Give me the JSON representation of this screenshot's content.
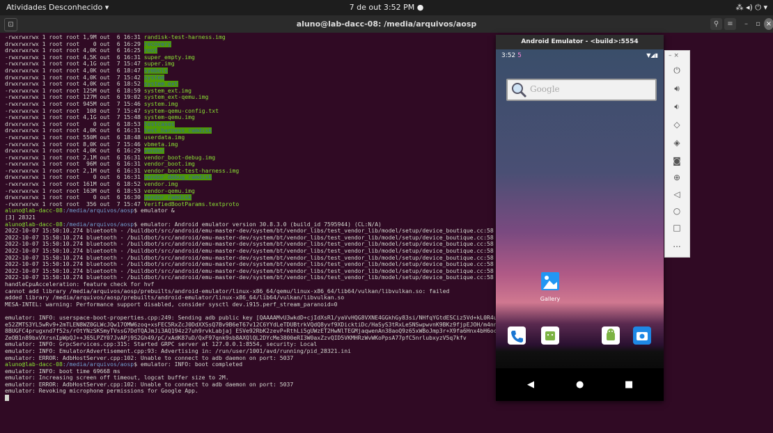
{
  "topbar": {
    "activities": "Atividades",
    "app_menu": "Desconhecido ▾",
    "clock": "7 de out  3:52 PM ●",
    "tray": "⁂ ◂) ⏻ ▾"
  },
  "window": {
    "title": "aluno@lab-dacc-08: /media/arquivos/aosp"
  },
  "terminal": {
    "lines": [
      {
        "pre": "-rwxrwxrwx 1 root root 1,9M out  6 16:31 ",
        "name": "randisk-test-harness.img",
        "style": "green"
      },
      {
        "pre": "drwxrwxrwx 1 root root    0 out  6 16:29 ",
        "name": "recovery",
        "style": "hl"
      },
      {
        "pre": "drwxrwxrwx 1 root root 4,0K out  6 16:25 ",
        "name": "root",
        "style": "hl"
      },
      {
        "pre": "-rwxrwxrwx 1 root root 4,5K out  6 16:31 ",
        "name": "super_empty.img",
        "style": "green"
      },
      {
        "pre": "-rwxrwxrwx 1 root root 4,1G out  7 15:47 ",
        "name": "super.img",
        "style": "green"
      },
      {
        "pre": "drwxrwxrwx 1 root root 4,0K out  6 18:47 ",
        "name": "symbols",
        "style": "hl"
      },
      {
        "pre": "drwxrwxrwx 1 root root 4,0K out  7 15:42 ",
        "name": "system",
        "style": "hl"
      },
      {
        "pre": "drwxrwxrwx 1 root root 4,0K out  6 18:52 ",
        "name": "system_ext",
        "style": "hl"
      },
      {
        "pre": "-rwxrwxrwx 1 root root 125M out  6 18:59 ",
        "name": "system_ext.img",
        "style": "green"
      },
      {
        "pre": "-rwxrwxrwx 1 root root 127M out  6 19:02 ",
        "name": "system_ext-qemu.img",
        "style": "green"
      },
      {
        "pre": "-rwxrwxrwx 1 root root 945M out  7 15:46 ",
        "name": "system.img",
        "style": "green"
      },
      {
        "pre": "-rwxrwxrwx 1 root root  108 out  7 15:47 ",
        "name": "system-qemu-config.txt",
        "style": "green"
      },
      {
        "pre": "-rwxrwxrwx 1 root root 4,1G out  7 15:48 ",
        "name": "system-qemu.img",
        "style": "green"
      },
      {
        "pre": "drwxrwxrwx 1 root root    0 out  6 18:53 ",
        "name": "testcases",
        "style": "hl"
      },
      {
        "pre": "drwxrwxrwx 1 root root 4,0K out  6 16:31 ",
        "name": "test_harness_ramdisk",
        "style": "hl"
      },
      {
        "pre": "-rwxrwxrwx 1 root root 550M out  6 18:48 ",
        "name": "userdata.img",
        "style": "green"
      },
      {
        "pre": "-rwxrwxrwx 1 root root 8,0K out  7 15:46 ",
        "name": "vbmeta.img",
        "style": "green"
      },
      {
        "pre": "drwxrwxrwx 1 root root 4,0K out  6 16:29 ",
        "name": "vendor",
        "style": "hl"
      },
      {
        "pre": "-rwxrwxrwx 1 root root 2,1M out  6 16:31 ",
        "name": "vendor_boot-debug.img",
        "style": "green"
      },
      {
        "pre": "-rwxrwxrwx 1 root root  96M out  6 16:31 ",
        "name": "vendor_boot.img",
        "style": "green"
      },
      {
        "pre": "-rwxrwxrwx 1 root root 2,1M out  6 16:31 ",
        "name": "vendor_boot-test-harness.img",
        "style": "green"
      },
      {
        "pre": "drwxrwxrwx 1 root root    0 out  6 16:31 ",
        "name": "vendor_debug_ramdisk",
        "style": "hl"
      },
      {
        "pre": "-rwxrwxrwx 1 root root 161M out  6 18:52 ",
        "name": "vendor.img",
        "style": "green"
      },
      {
        "pre": "-rwxrwxrwx 1 root root 163M out  6 18:53 ",
        "name": "vendor-qemu.img",
        "style": "green"
      },
      {
        "pre": "drwxrwxrwx 1 root root    0 out  6 16:30 ",
        "name": "vendor_ramdisk",
        "style": "hl"
      },
      {
        "pre": "-rwxrwxrwx 1 root root  356 out  7 15:47 ",
        "name": "VerifiedBootParams.textproto",
        "style": "green"
      },
      {
        "prompt_user": "aluno@lab-dacc-08",
        "prompt_path": ":/media/arquivos/aosp",
        "rest": "$ emulator &"
      },
      {
        "text": "[3] 28321"
      },
      {
        "prompt_user": "aluno@lab-dacc-08",
        "prompt_path": ":/media/arquivos/aosp",
        "rest": "$ emulator: Android emulator version 30.8.3.0 (build_id 7595944) (CL:N/A)"
      },
      {
        "text": "2022-10-07 15:50:10.274 bluetooth - /buildbot/src/android/emu-master-dev/system/bt/vendor_libs/test_vendor_lib/model/setup/device_boutique.cc:58 - Register"
      },
      {
        "text": "2022-10-07 15:50:10.274 bluetooth - /buildbot/src/android/emu-master-dev/system/bt/vendor_libs/test_vendor_lib/model/setup/device_boutique.cc:58 - Register"
      },
      {
        "text": "2022-10-07 15:50:10.274 bluetooth - /buildbot/src/android/emu-master-dev/system/bt/vendor_libs/test_vendor_lib/model/setup/device_boutique.cc:58 - Register"
      },
      {
        "text": "2022-10-07 15:50:10.274 bluetooth - /buildbot/src/android/emu-master-dev/system/bt/vendor_libs/test_vendor_lib/model/setup/device_boutique.cc:58 - Register"
      },
      {
        "text": "2022-10-07 15:50:10.274 bluetooth - /buildbot/src/android/emu-master-dev/system/bt/vendor_libs/test_vendor_lib/model/setup/device_boutique.cc:58 - Register"
      },
      {
        "text": "2022-10-07 15:50:10.274 bluetooth - /buildbot/src/android/emu-master-dev/system/bt/vendor_libs/test_vendor_lib/model/setup/device_boutique.cc:58 - Register"
      },
      {
        "text": "2022-10-07 15:50:10.274 bluetooth - /buildbot/src/android/emu-master-dev/system/bt/vendor_libs/test_vendor_lib/model/setup/device_boutique.cc:58 - Register"
      },
      {
        "text": "2022-10-07 15:50:10.274 bluetooth - /buildbot/src/android/emu-master-dev/system/bt/vendor_libs/test_vendor_lib/model/setup/device_boutique.cc:58 - Register"
      },
      {
        "text": "handleCpuAcceleration: feature check for hvf"
      },
      {
        "text": "cannot add library /media/arquivos/aosp/prebuilts/android-emulator/linux-x86_64/qemu/linux-x86_64/lib64/vulkan/libvulkan.so: failed"
      },
      {
        "text": "added library /media/arquivos/aosp/prebuilts/android-emulator/linux-x86_64/lib64/vulkan/libvulkan.so"
      },
      {
        "text": "MESA-INTEL: warning: Performance support disabled, consider sysctl dev.i915.perf_stream_paranoid=0"
      },
      {
        "text": ""
      },
      {
        "text": "emulator: INFO: userspace-boot-properties.cpp:249: Sending adb public key [QAAAAMvU3wkdD+cjIdXsR1/yaVvHQG8VXNE4GGkhGy83si/NHfqYGtdESCiz5Vd+kL0R4usgbm03Z8XX2BfVlyGRORic4PUo1"
      },
      {
        "text": "e52ZMTS3YL5wRv9+2mTLEN8WZ0GLWcJQw17OMW6zoq+xsFEC5RxZcJ0DdXXSsQ7Bv9B6eT67v12C6YYdLeTDUBtrkVQdQ8yvf9XDicktiDc/HaSyS3tRxLeSNSwpwvnK9BKz9fjpEJOH/m4nnLY1BpxSba5XpLSCP2pX6Se"
      },
      {
        "text": "8BUGFC4prugxnd7f52s/rOtYNzSKSmyTVssG7DdTQAJmJi3AQ194z27uh9rvkLabjaj ESVe92RbK2zevP+RthLi5gUWzET2HwNlTEGMjaqwenAn38aoQ9z65xWBoJmp3r+X9fa6Hnx4bH6ocRb1iPogKwA+xkp1qBJAHr"
      },
      {
        "text": "ZeOB1n89bxVXrsnIpWpQJ++J65LPZY07JvAPj9S2Gh49/pC/xAdK87uD/QxF97qnk9sb8AXQlQL2DYcMe3800eRI3W0axZzvQID5VKMHRzWvWKoPpsA77pfC5nrlubxyzV5q7kfv"
      },
      {
        "text": "emulator: INFO: GrpcServices.cpp:315: Started GRPC server at 127.0.0.1:8554, security: Local"
      },
      {
        "text": "emulator: INFO: EmulatorAdvertisement.cpp:93: Advertising in: /run/user/1001/avd/running/pid_28321.ini"
      },
      {
        "text": "emulator: ERROR: AdbHostServer.cpp:102: Unable to connect to adb daemon on port: 5037"
      },
      {
        "prompt_user": "aluno@lab-dacc-08",
        "prompt_path": ":/media/arquivos/aosp",
        "rest": "$ emulator: INFO: boot completed"
      },
      {
        "text": "emulator: INFO: boot time 69668 ms"
      },
      {
        "text": "emulator: Increasing screen off timeout, logcat buffer size to 2M."
      },
      {
        "text": "emulator: ERROR: AdbHostServer.cpp:102: Unable to connect to adb daemon on port: 5037"
      },
      {
        "text": "emulator: Revoking microphone permissions for Google App."
      },
      {
        "cursor": true
      }
    ]
  },
  "emulator": {
    "title": "Android Emulator - <build>:5554",
    "status_time": "3:52",
    "status_icon": "5",
    "status_right": "▼◢▮",
    "search_placeholder": "Google",
    "gallery_label": "Gallery",
    "sidebar_top": "–  ×",
    "sidebar_more": "..."
  }
}
